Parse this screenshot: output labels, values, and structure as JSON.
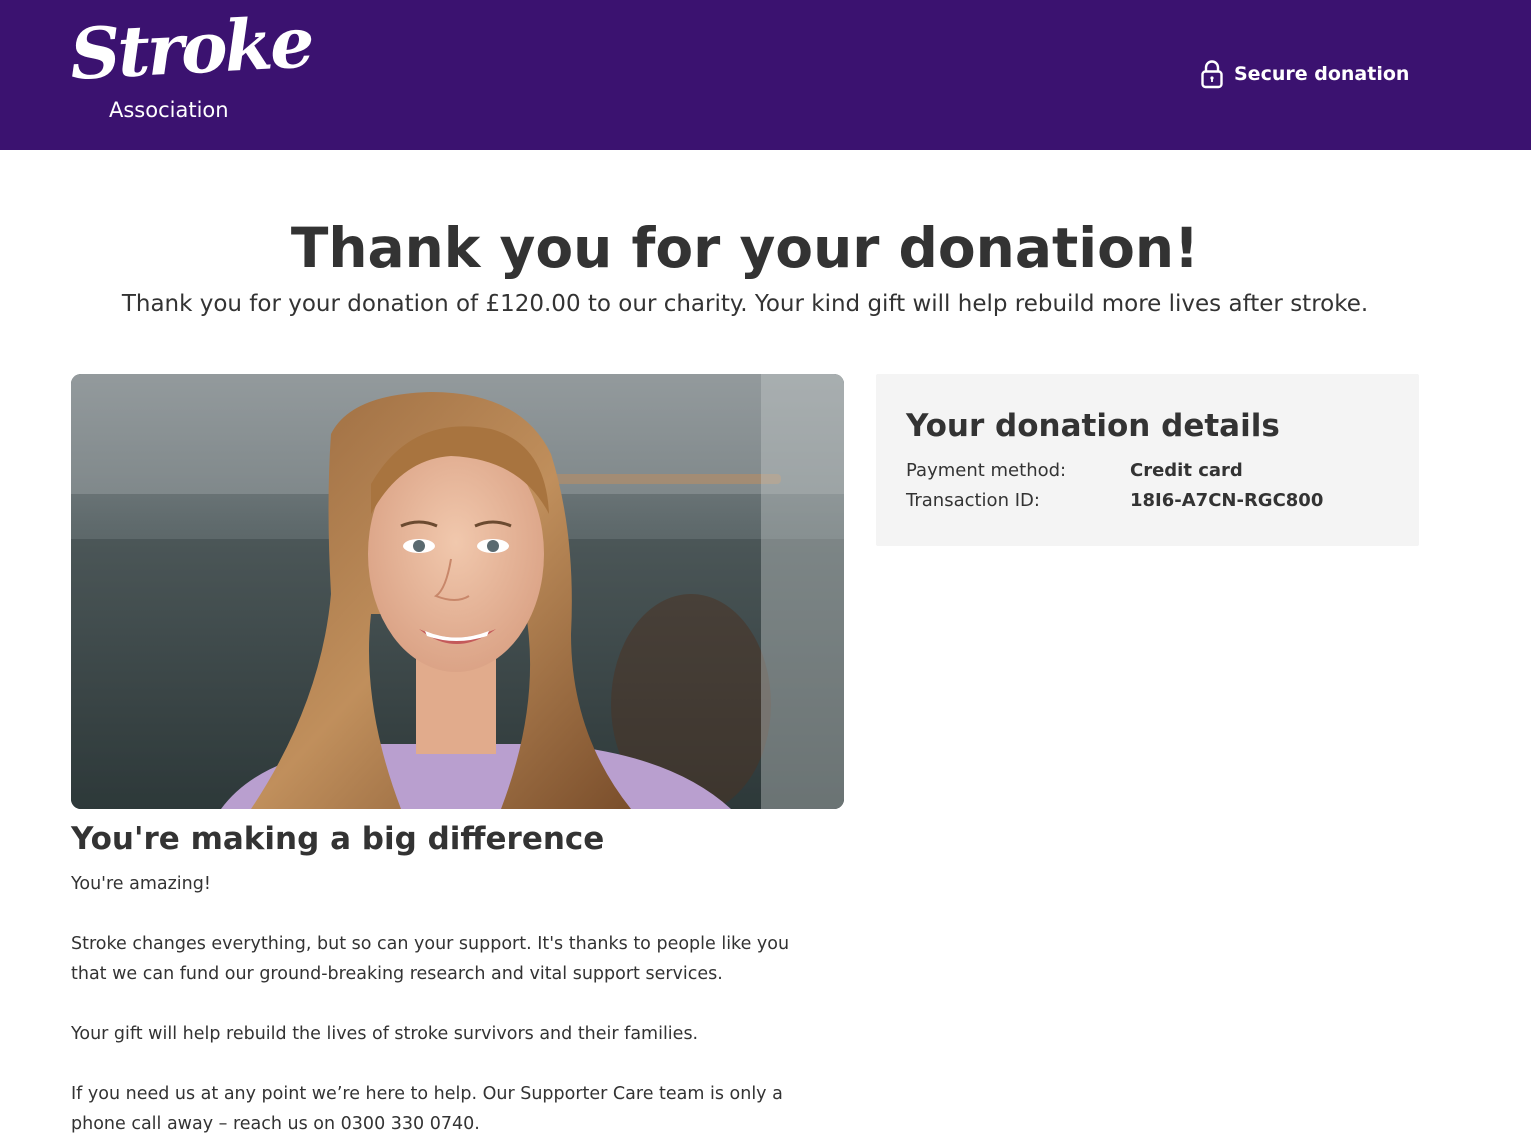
{
  "header": {
    "logo": {
      "wordmark": "Stroke",
      "subtitle": "Association"
    },
    "secure_label": "Secure donation",
    "secure_icon": "lock-icon",
    "background": "#3b1270"
  },
  "main": {
    "title": "Thank you for your donation!",
    "subtitle": "Thank you for your donation of £120.00 to our charity. Your kind gift will help rebuild more lives after stroke."
  },
  "donation_details": {
    "title": "Your donation details",
    "rows": [
      {
        "label": "Payment method:",
        "value": "Credit card"
      },
      {
        "label": "Transaction ID:",
        "value": "18I6-A7CN-RGC800"
      }
    ]
  },
  "content": {
    "heading": "You're making a big difference",
    "paragraphs": [
      "You're amazing!",
      "Stroke changes everything, but so can your support. It's thanks to people like you that we can fund our ground-breaking research and vital support services.",
      "Your gift will help rebuild the lives of stroke survivors and their families.",
      "If you need us at any point we’re here to help. Our Supporter Care team is only a phone call away – reach us on 0300 330 0740."
    ]
  }
}
